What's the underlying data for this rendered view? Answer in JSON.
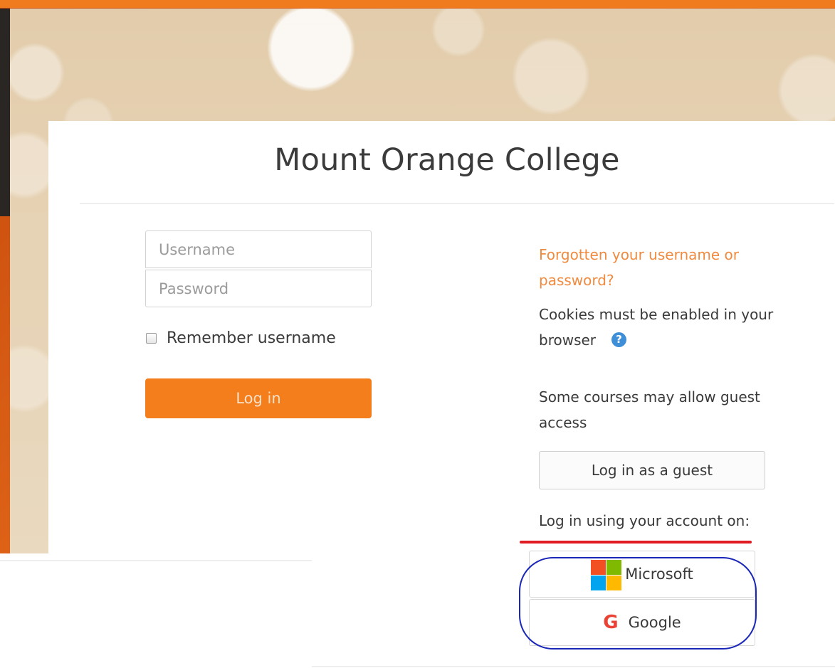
{
  "site": {
    "title": "Mount Orange College"
  },
  "login_form": {
    "username_placeholder": "Username",
    "password_placeholder": "Password",
    "remember_label": "Remember username",
    "login_button": "Log in"
  },
  "help": {
    "forgot_link": "Forgotten your username or password?",
    "cookies_text": "Cookies must be enabled in your browser",
    "help_icon": "question-circle-icon",
    "guest_text": "Some courses may allow guest access",
    "guest_button": "Log in as a guest",
    "account_text": "Log in using your account on:"
  },
  "identity_providers": [
    {
      "label": "Microsoft",
      "icon": "microsoft-logo-icon"
    },
    {
      "label": "Google",
      "icon": "google-logo-icon"
    }
  ],
  "colors": {
    "accent": "#f47d1c",
    "link": "#f08a3e",
    "annotation_red": "#e01b24",
    "annotation_blue": "#1a27b8",
    "microsoft_red": "#f25022",
    "microsoft_green": "#7fba00",
    "microsoft_blue": "#00a4ef",
    "microsoft_yellow": "#ffb900"
  }
}
